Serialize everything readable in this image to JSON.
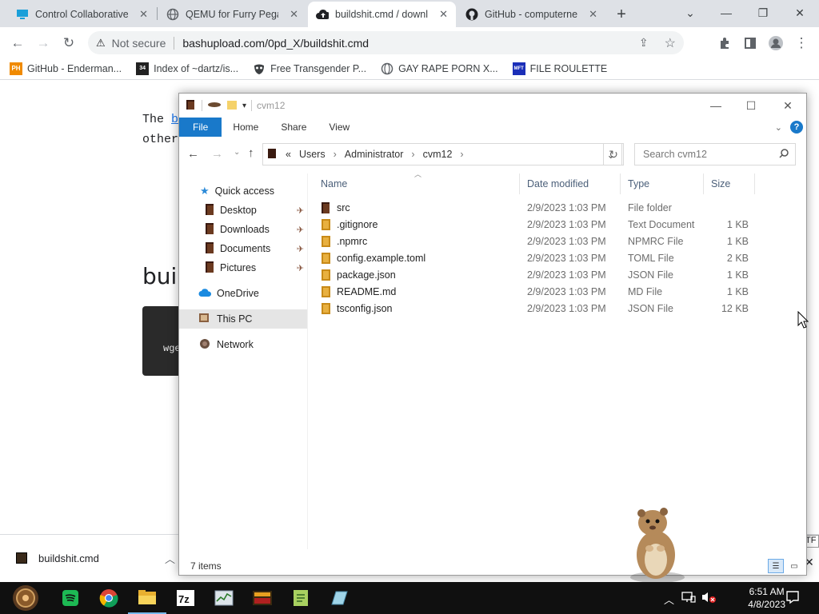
{
  "browser": {
    "tabs": [
      {
        "title": "Control Collaborative",
        "icon": "monitor-icon",
        "active": false
      },
      {
        "title": "QEMU for Furry Pega",
        "icon": "globe-icon",
        "active": false
      },
      {
        "title": "buildshit.cmd / downlo",
        "icon": "cloud-upload-icon",
        "active": true
      },
      {
        "title": "GitHub - computernew",
        "icon": "github-icon",
        "active": false
      }
    ],
    "new_tab": "+",
    "security": "Not secure",
    "url": "bashupload.com/0pd_X/buildshit.cmd",
    "bookmarks": [
      {
        "label": "GitHub - Enderman...",
        "icon": "PH"
      },
      {
        "label": "Index of ~dartz/is...",
        "icon": "34"
      },
      {
        "label": "Free Transgender P...",
        "icon": "mask"
      },
      {
        "label": "GAY RAPE PORN X...",
        "icon": "globe"
      },
      {
        "label": "FILE ROULETTE",
        "icon": "MFT"
      }
    ]
  },
  "page": {
    "line1_start": "The",
    "line1_link": "b",
    "line2": "other",
    "heading": "bui",
    "code": "wge"
  },
  "shelf": {
    "filename": "buildshit.cmd",
    "edge_text": "TF"
  },
  "explorer": {
    "title": "cvm12",
    "ribbon": [
      "File",
      "Home",
      "Share",
      "View"
    ],
    "breadcrumb": [
      "«",
      "Users",
      "Administrator",
      "cvm12"
    ],
    "search_placeholder": "Search cvm12",
    "nav": {
      "quick_access": "Quick access",
      "pinned": [
        "Desktop",
        "Downloads",
        "Documents",
        "Pictures"
      ],
      "onedrive": "OneDrive",
      "this_pc": "This PC",
      "network": "Network"
    },
    "columns": [
      "Name",
      "Date modified",
      "Type",
      "Size"
    ],
    "files": [
      {
        "name": "src",
        "date": "2/9/2023 1:03 PM",
        "type": "File folder",
        "size": ""
      },
      {
        "name": ".gitignore",
        "date": "2/9/2023 1:03 PM",
        "type": "Text Document",
        "size": "1 KB"
      },
      {
        "name": ".npmrc",
        "date": "2/9/2023 1:03 PM",
        "type": "NPMRC File",
        "size": "1 KB"
      },
      {
        "name": "config.example.toml",
        "date": "2/9/2023 1:03 PM",
        "type": "TOML File",
        "size": "2 KB"
      },
      {
        "name": "package.json",
        "date": "2/9/2023 1:03 PM",
        "type": "JSON File",
        "size": "1 KB"
      },
      {
        "name": "README.md",
        "date": "2/9/2023 1:03 PM",
        "type": "MD File",
        "size": "1 KB"
      },
      {
        "name": "tsconfig.json",
        "date": "2/9/2023 1:03 PM",
        "type": "JSON File",
        "size": "12 KB"
      }
    ],
    "status": "7 items"
  },
  "taskbar": {
    "apps": [
      "start-orb",
      "spotify",
      "chrome",
      "file-explorer",
      "7zip",
      "task-manager",
      "winamp",
      "notepad-plus",
      "sticky-app"
    ],
    "time": "6:51 AM",
    "date": "4/8/2023"
  }
}
